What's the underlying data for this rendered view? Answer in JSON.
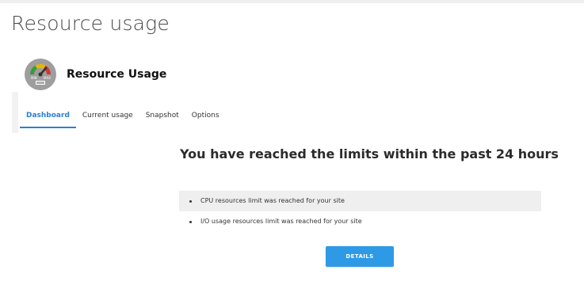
{
  "page": {
    "title": "Resource usage"
  },
  "plugin": {
    "name": "Resource Usage",
    "icon": "gauge-icon",
    "gauge_labels": {
      "min": "MIN",
      "max": "MAX"
    }
  },
  "tabs": [
    {
      "label": "Dashboard",
      "active": true
    },
    {
      "label": "Current usage",
      "active": false
    },
    {
      "label": "Snapshot",
      "active": false
    },
    {
      "label": "Options",
      "active": false
    }
  ],
  "dashboard": {
    "headline": "You have reached the limits within the past 24 hours",
    "alerts": [
      "CPU resources limit was reached for your site",
      "I/O usage resources limit was reached for your site"
    ],
    "details_label": "DETAILS"
  },
  "colors": {
    "accent": "#2a7fd4",
    "button": "#2e9ae6",
    "row_shade": "#efefef"
  }
}
